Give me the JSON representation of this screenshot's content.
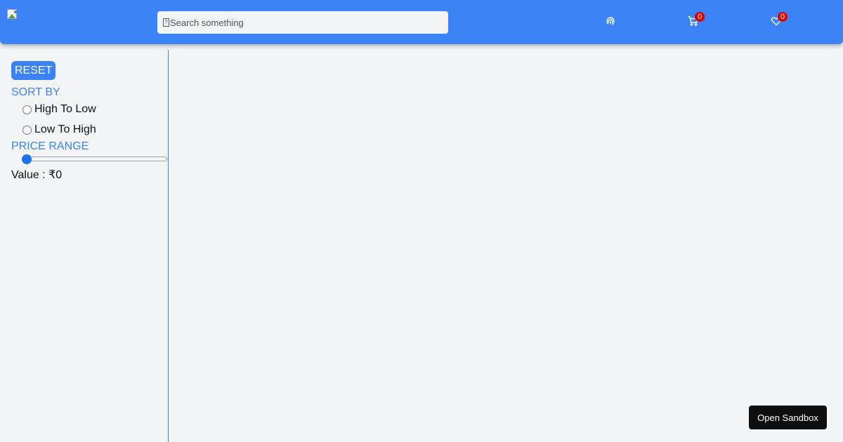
{
  "navbar": {
    "logo_icon": "broken-image-icon",
    "search": {
      "placeholder": "Search something",
      "icon": "missing-glyph-icon"
    },
    "icons": {
      "fingerprint": "fingerprint-icon",
      "cart": "cart-icon",
      "wishlist": "heart-icon"
    },
    "cart_count": "0",
    "wishlist_count": "0",
    "colors": {
      "primary": "#3b82f6",
      "badge": "#e00000"
    }
  },
  "sidebar": {
    "reset_label": "RESET",
    "sort_title": "SORT BY",
    "sort_options": [
      "High To Low",
      "Low To High"
    ],
    "price_title": "PRICE RANGE",
    "price_value": 0,
    "value_label": "Value : ₹0"
  },
  "footer": {
    "sandbox_label": "Open Sandbox"
  }
}
